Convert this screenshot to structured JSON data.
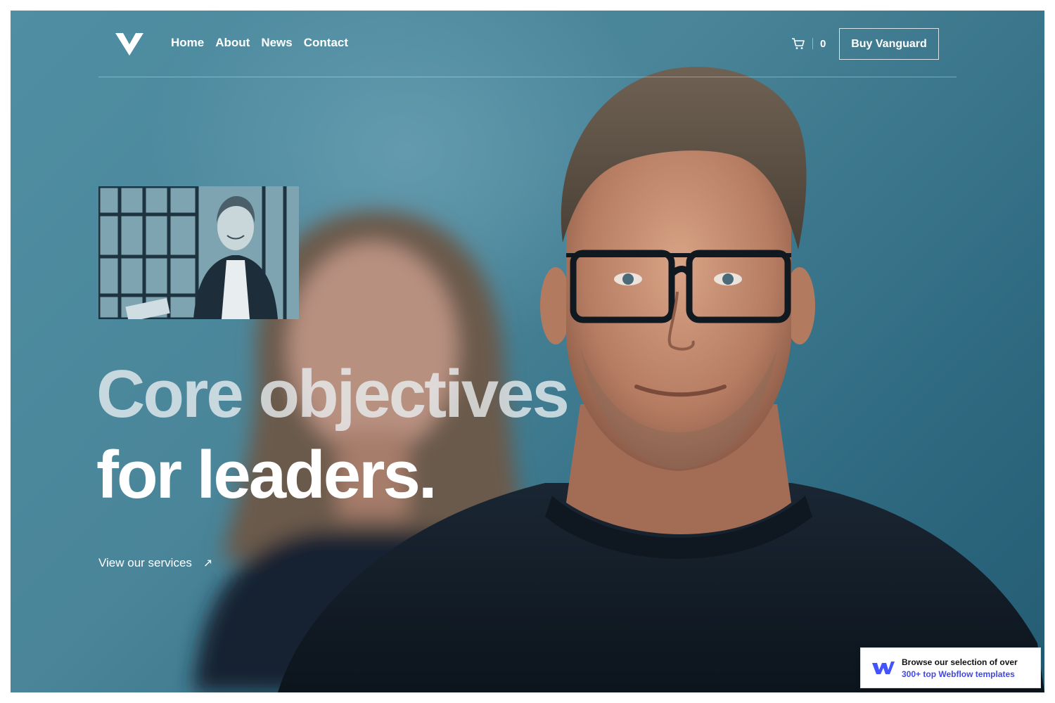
{
  "nav": {
    "links": [
      "Home",
      "About",
      "News",
      "Contact"
    ],
    "cart_count": "0",
    "buy_label": "Buy Vanguard"
  },
  "hero": {
    "headline_line1": "Core objectives",
    "headline_line2": "for leaders.",
    "cta_label": "View our services",
    "cta_arrow": "↗"
  },
  "badge": {
    "line1": "Browse our selection of over",
    "line2": "300+ top Webflow templates"
  },
  "colors": {
    "background": "#4a8599",
    "text": "#ffffff",
    "badge_link": "#3f48e8"
  },
  "icons": {
    "logo": "vanguard-v-logo",
    "cart": "shopping-cart-icon",
    "cta": "arrow-up-right-icon",
    "badge": "webflow-logo-icon"
  }
}
